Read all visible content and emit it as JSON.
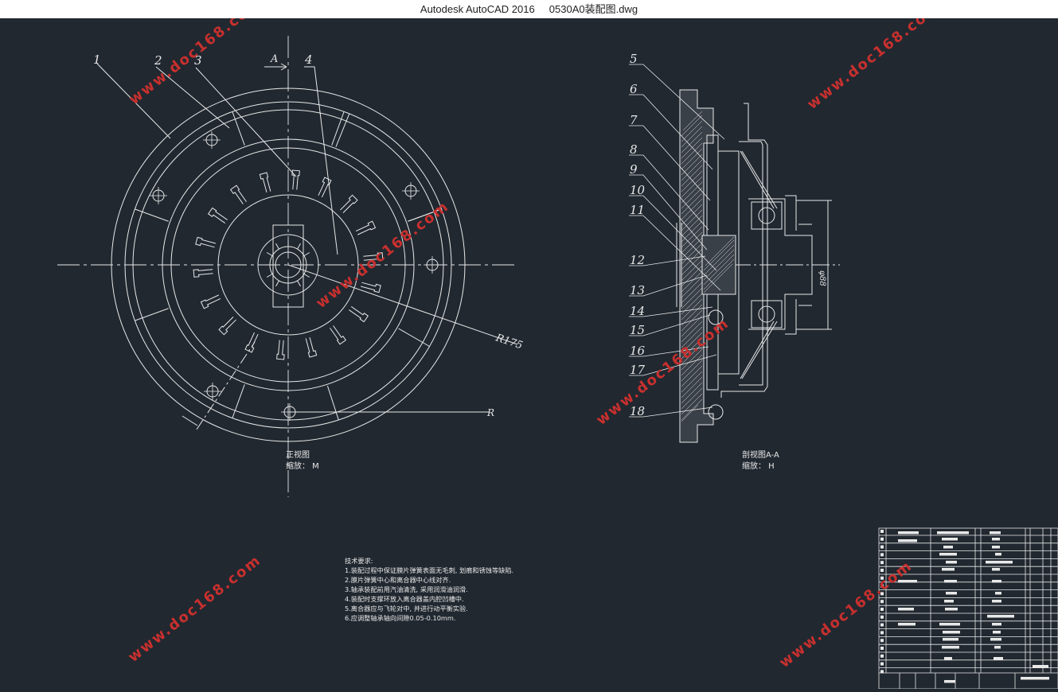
{
  "window": {
    "app": "Autodesk AutoCAD 2016",
    "file": "0530A0装配图.dwg"
  },
  "front_view": {
    "section_mark": "A",
    "part_numbers": [
      "1",
      "2",
      "3",
      "4"
    ],
    "dimension_r": "R175",
    "dimension_r2": "R",
    "caption_title": "正视图",
    "caption_scale": "缩放： M"
  },
  "section_view": {
    "part_numbers": [
      "5",
      "6",
      "7",
      "8",
      "9",
      "10",
      "11",
      "12",
      "13",
      "14",
      "15",
      "16",
      "17",
      "18"
    ],
    "dimension": "φ88",
    "caption_title": "剖视图A-A",
    "caption_scale": "缩放： H"
  },
  "notes": {
    "heading": "技术要求:",
    "items": [
      "1.装配过程中保证膜片弹簧表面无毛刺, 划痕和锈蚀等缺陷.",
      "2.膜片弹簧中心和离合器中心线对齐.",
      "3.轴承装配前用汽油清洗, 采用润滑油润滑.",
      "4.装配时支撑环放入离合器盖内腔凹槽中.",
      "5.离合器应与飞轮对中, 并进行动平衡实验.",
      "6.应调整轴承轴向间隙0.05-0.10mm."
    ]
  },
  "watermarks": [
    "www.doc168.com"
  ],
  "colors": {
    "background": "#212830",
    "line": "#e8e8e8",
    "watermark": "#c8302e",
    "titlebar": "#ffffff"
  }
}
